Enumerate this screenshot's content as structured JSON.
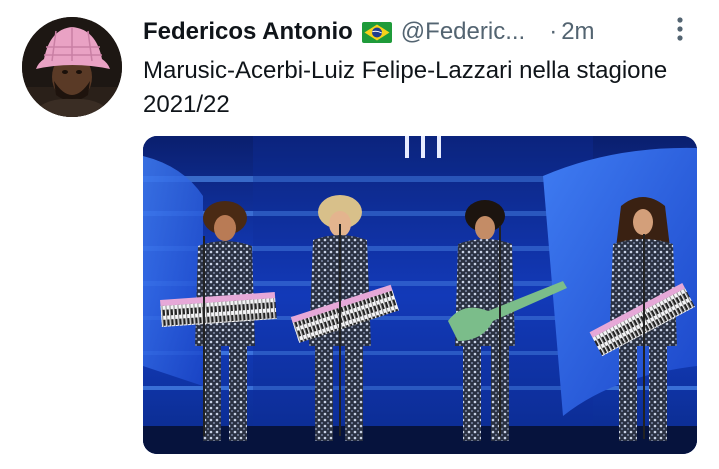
{
  "tweet": {
    "author_name": "Federicos Antonio",
    "flag_icon": "flag-brazil-icon",
    "handle": "@Federic...",
    "separator": "·",
    "timestamp": "2m",
    "more_icon": "more-options-icon",
    "text": "Marusic-Acerbi-Luiz Felipe-Lazzari nella stagione 2021/22",
    "media": {
      "description_icon": "stage-photo"
    }
  },
  "colors": {
    "text_primary": "#0f1419",
    "text_secondary": "#536471",
    "stage_blue": "#1f4fd8"
  }
}
